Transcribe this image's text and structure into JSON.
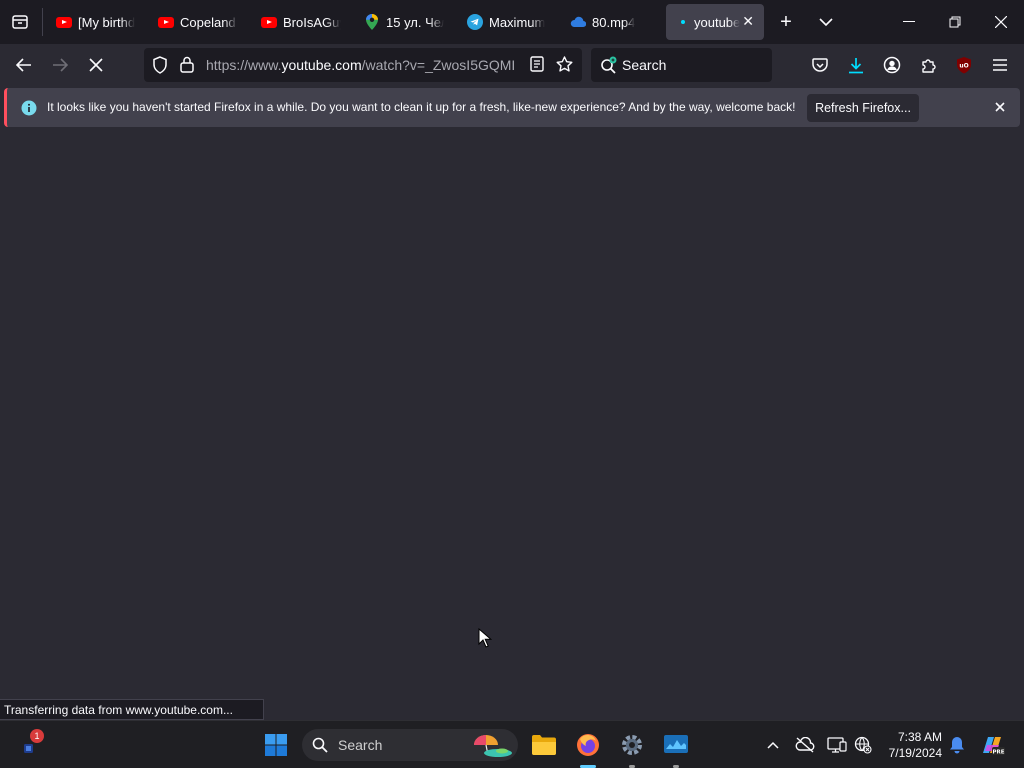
{
  "tabs": [
    {
      "title": "[My birthd",
      "icon": "youtube-icon"
    },
    {
      "title": "Copeland I",
      "icon": "youtube-icon"
    },
    {
      "title": "BroIsAGuy",
      "icon": "youtube-icon"
    },
    {
      "title": "15 ул. Чел",
      "icon": "maps-pin-icon"
    },
    {
      "title": "Maximum",
      "icon": "telegram-icon"
    },
    {
      "title": "80.mp4",
      "icon": "cloud-icon"
    },
    {
      "title": "youtube",
      "icon": "loading-dot-icon",
      "active": true
    }
  ],
  "navbar": {
    "url_prefix": "https://www.",
    "url_domain": "youtube.com",
    "url_rest": "/watch?v=_ZwosI5GQMI",
    "search_placeholder": "Search"
  },
  "notification": {
    "message": "It looks like you haven't started Firefox in a while. Do you want to clean it up for a fresh, like-new experience? And by the way, welcome back!",
    "button_label": "Refresh Firefox..."
  },
  "status": {
    "text": "Transferring data from www.youtube.com..."
  },
  "taskbar": {
    "search_placeholder": "Search",
    "time": "7:38 AM",
    "date": "7/19/2024",
    "notification_badge": "1"
  },
  "colors": {
    "accent": "#00ddff",
    "notification_stripe": "#ff4f5e",
    "background": "#2b2a33"
  }
}
